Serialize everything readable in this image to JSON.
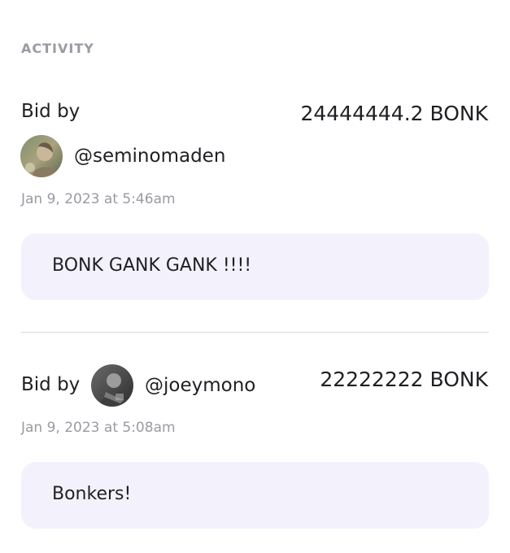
{
  "activity": {
    "title": "ACTIVITY",
    "bids": [
      {
        "label": "Bid by",
        "amount": "24444444.2 BONK",
        "handle": "@seminomaden",
        "avatar_icon": "user-avatar-photo",
        "timestamp": "Jan 9, 2023 at 5:46am",
        "message": "BONK GANK GANK !!!!"
      },
      {
        "label": "Bid by",
        "amount": "22222222 BONK",
        "handle": "@joeymono",
        "avatar_icon": "user-avatar-photo",
        "timestamp": "Jan 9, 2023 at 5:08am",
        "message": "Bonkers!"
      }
    ]
  },
  "colors": {
    "message_background": "#f3f2fc",
    "muted_text": "#9a9aa2",
    "primary_text": "#1f1f24",
    "divider": "#d9d9de"
  }
}
